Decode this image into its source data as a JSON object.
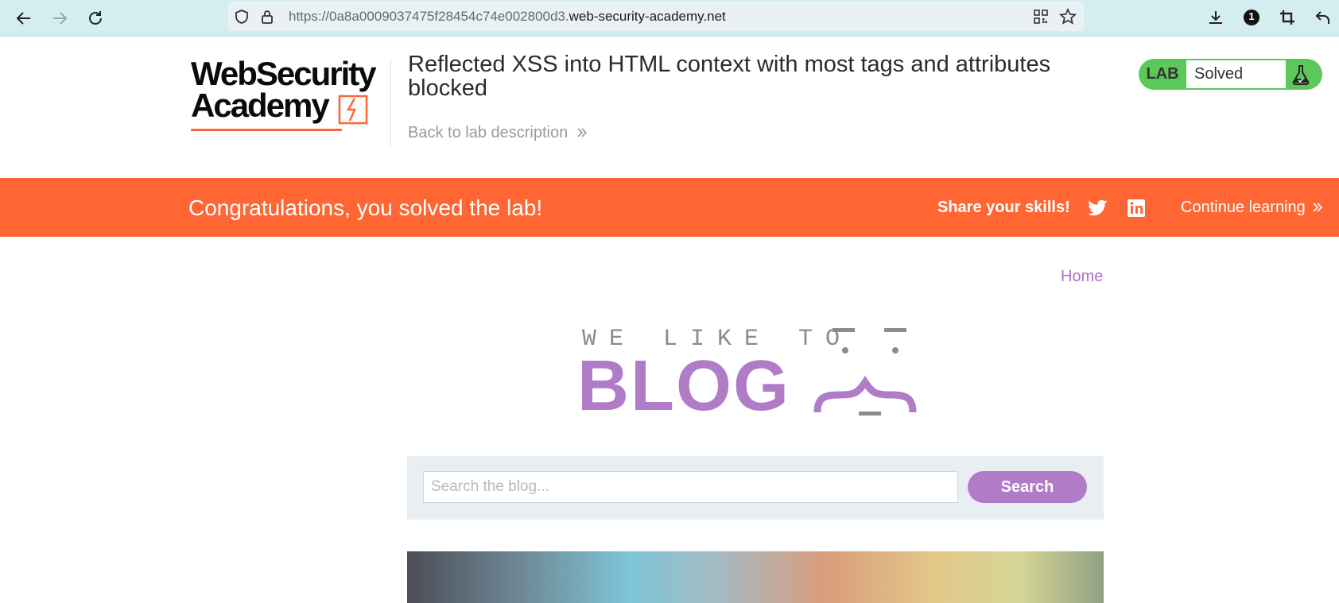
{
  "browser": {
    "url_prefix": "https://0a8a0009037475f28454c74e002800d3.",
    "url_domain": "web-security-academy.net",
    "notification_count": "1"
  },
  "lab_header": {
    "logo_line1": "WebSecurity",
    "logo_line2": "Academy",
    "title": "Reflected XSS into HTML context with most tags and attributes blocked",
    "back_link": "Back to lab description",
    "status_label": "LAB",
    "status_value": "Solved",
    "status_color": "#5cc85a"
  },
  "banner": {
    "message": "Congratulations, you solved the lab!",
    "share_label": "Share your skills!",
    "continue_label": "Continue learning",
    "background_color": "#ff6633"
  },
  "blog": {
    "nav_home": "Home",
    "logo_small": "WE LIKE TO",
    "logo_big": "BLOG",
    "search_placeholder": "Search the blog...",
    "search_value": "",
    "search_button": "Search",
    "accent_color": "#b07bc7"
  },
  "icons": [
    "back-icon",
    "forward-icon",
    "reload-icon",
    "shield-icon",
    "lock-icon",
    "qr-code-icon",
    "star-icon",
    "download-icon",
    "notification-icon",
    "crop-icon",
    "undo-icon",
    "flask-icon",
    "twitter-icon",
    "linkedin-icon",
    "double-chevron-icon"
  ]
}
